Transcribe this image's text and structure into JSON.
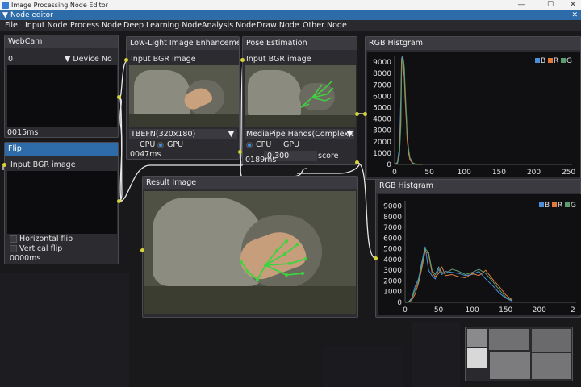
{
  "window": {
    "title": "Image Processing Node Editor",
    "minimize": "—",
    "maximize": "☐",
    "close": "✕"
  },
  "editor": {
    "collapse_glyph": "▼",
    "label": "Node editor",
    "close_glyph": "✕"
  },
  "menu": [
    "File",
    "Input Node",
    "Process Node",
    "Deep Learning Node",
    "Analysis Node",
    "Draw Node",
    "Other Node"
  ],
  "nodes": {
    "webcam": {
      "title": "WebCam",
      "device_value": "0",
      "device_label": "▼ Device No",
      "elapsed": "0015ms"
    },
    "flip": {
      "title": "Flip",
      "input_label": "Input BGR image",
      "horizontal": "Horizontal flip",
      "vertical": "Vertical flip",
      "elapsed": "0000ms"
    },
    "lowlight": {
      "title": "Low-Light Image Enhancement",
      "input_label": "Input BGR image",
      "model": "TBEFN(320x180)",
      "cpu": "CPU",
      "gpu": "GPU",
      "elapsed": "0047ms"
    },
    "pose": {
      "title": "Pose Estimation",
      "input_label": "Input BGR image",
      "model": "MediaPipe Hands(Complexit",
      "cpu": "CPU",
      "gpu": "GPU",
      "score_value": "0.300",
      "score_label": "score",
      "elapsed": "0189ms"
    },
    "result": {
      "title": "Result Image"
    }
  },
  "colors": {
    "accent": "#2d6ca8",
    "port": "#d8d23a",
    "B": "#4a90d9",
    "R": "#e07a3c",
    "G": "#5a9e6f",
    "landmark": "#3fd23f"
  },
  "combo_arrow": "▼",
  "chart_data": [
    {
      "type": "line",
      "title": "RGB Histgram",
      "xlim": [
        0,
        255
      ],
      "ylim": [
        0,
        9500
      ],
      "xticks": [
        "0",
        "50",
        "100",
        "150",
        "200",
        "250"
      ],
      "yticks": [
        "0",
        "1000",
        "2000",
        "3000",
        "4000",
        "5000",
        "6000",
        "7000",
        "8000",
        "9000"
      ],
      "legend_position": "top-right",
      "series": [
        {
          "name": "B",
          "color": "#4a90d9",
          "x": [
            0,
            4,
            7,
            9,
            10,
            11,
            12,
            13,
            14,
            15,
            16,
            17,
            18,
            20,
            22,
            26,
            30,
            40
          ],
          "values": [
            0,
            200,
            1500,
            6000,
            9300,
            9500,
            9000,
            8000,
            7800,
            6500,
            5000,
            4000,
            2500,
            1200,
            500,
            120,
            30,
            0
          ]
        },
        {
          "name": "R",
          "color": "#e07a3c",
          "x": [
            0,
            4,
            7,
            9,
            10,
            11,
            12,
            13,
            14,
            15,
            16,
            17,
            18,
            20,
            22,
            26,
            30,
            40
          ],
          "values": [
            0,
            150,
            1000,
            4500,
            9000,
            9400,
            9200,
            8800,
            7500,
            6000,
            4800,
            3600,
            2200,
            1000,
            400,
            100,
            20,
            0
          ]
        },
        {
          "name": "G",
          "color": "#5a9e6f",
          "x": [
            0,
            4,
            7,
            9,
            10,
            11,
            12,
            13,
            14,
            15,
            16,
            17,
            18,
            20,
            22,
            26,
            30,
            40
          ],
          "values": [
            0,
            100,
            800,
            3500,
            8000,
            9300,
            9400,
            9100,
            8500,
            7000,
            5500,
            4200,
            2800,
            1400,
            600,
            150,
            40,
            0
          ]
        }
      ]
    },
    {
      "type": "line",
      "title": "RGB Histgram",
      "xlim": [
        0,
        255
      ],
      "ylim": [
        0,
        9500
      ],
      "xticks": [
        "0",
        "50",
        "100",
        "150",
        "200",
        "2"
      ],
      "yticks": [
        "0",
        "1000",
        "2000",
        "3000",
        "4000",
        "5000",
        "6000",
        "7000",
        "8000",
        "9000"
      ],
      "legend_position": "top-right",
      "series": [
        {
          "name": "B",
          "color": "#4a90d9",
          "x": [
            0,
            5,
            10,
            15,
            20,
            25,
            30,
            35,
            40,
            45,
            50,
            55,
            60,
            70,
            80,
            90,
            100,
            110,
            120,
            130,
            140,
            150,
            160
          ],
          "values": [
            0,
            50,
            400,
            1500,
            2200,
            3800,
            5200,
            3000,
            2500,
            2200,
            3100,
            2600,
            2900,
            2800,
            2700,
            2500,
            2600,
            2900,
            2200,
            1600,
            900,
            400,
            100
          ]
        },
        {
          "name": "R",
          "color": "#e07a3c",
          "x": [
            0,
            5,
            10,
            15,
            20,
            25,
            30,
            35,
            40,
            45,
            50,
            55,
            60,
            70,
            80,
            90,
            100,
            110,
            120,
            130,
            140,
            150,
            160
          ],
          "values": [
            0,
            30,
            200,
            800,
            1800,
            3200,
            4800,
            4500,
            2800,
            2400,
            2700,
            3300,
            2500,
            2600,
            2400,
            2300,
            2700,
            2500,
            3000,
            2200,
            1500,
            700,
            200
          ]
        },
        {
          "name": "G",
          "color": "#5a9e6f",
          "x": [
            0,
            5,
            10,
            15,
            20,
            25,
            30,
            35,
            40,
            45,
            50,
            55,
            60,
            70,
            80,
            90,
            100,
            110,
            120,
            130,
            140,
            150,
            160
          ],
          "values": [
            0,
            40,
            300,
            1200,
            2000,
            3500,
            5000,
            4700,
            3000,
            2600,
            3300,
            2800,
            2700,
            3100,
            2900,
            2600,
            2800,
            3100,
            2700,
            2000,
            1200,
            500,
            150
          ]
        }
      ]
    }
  ]
}
